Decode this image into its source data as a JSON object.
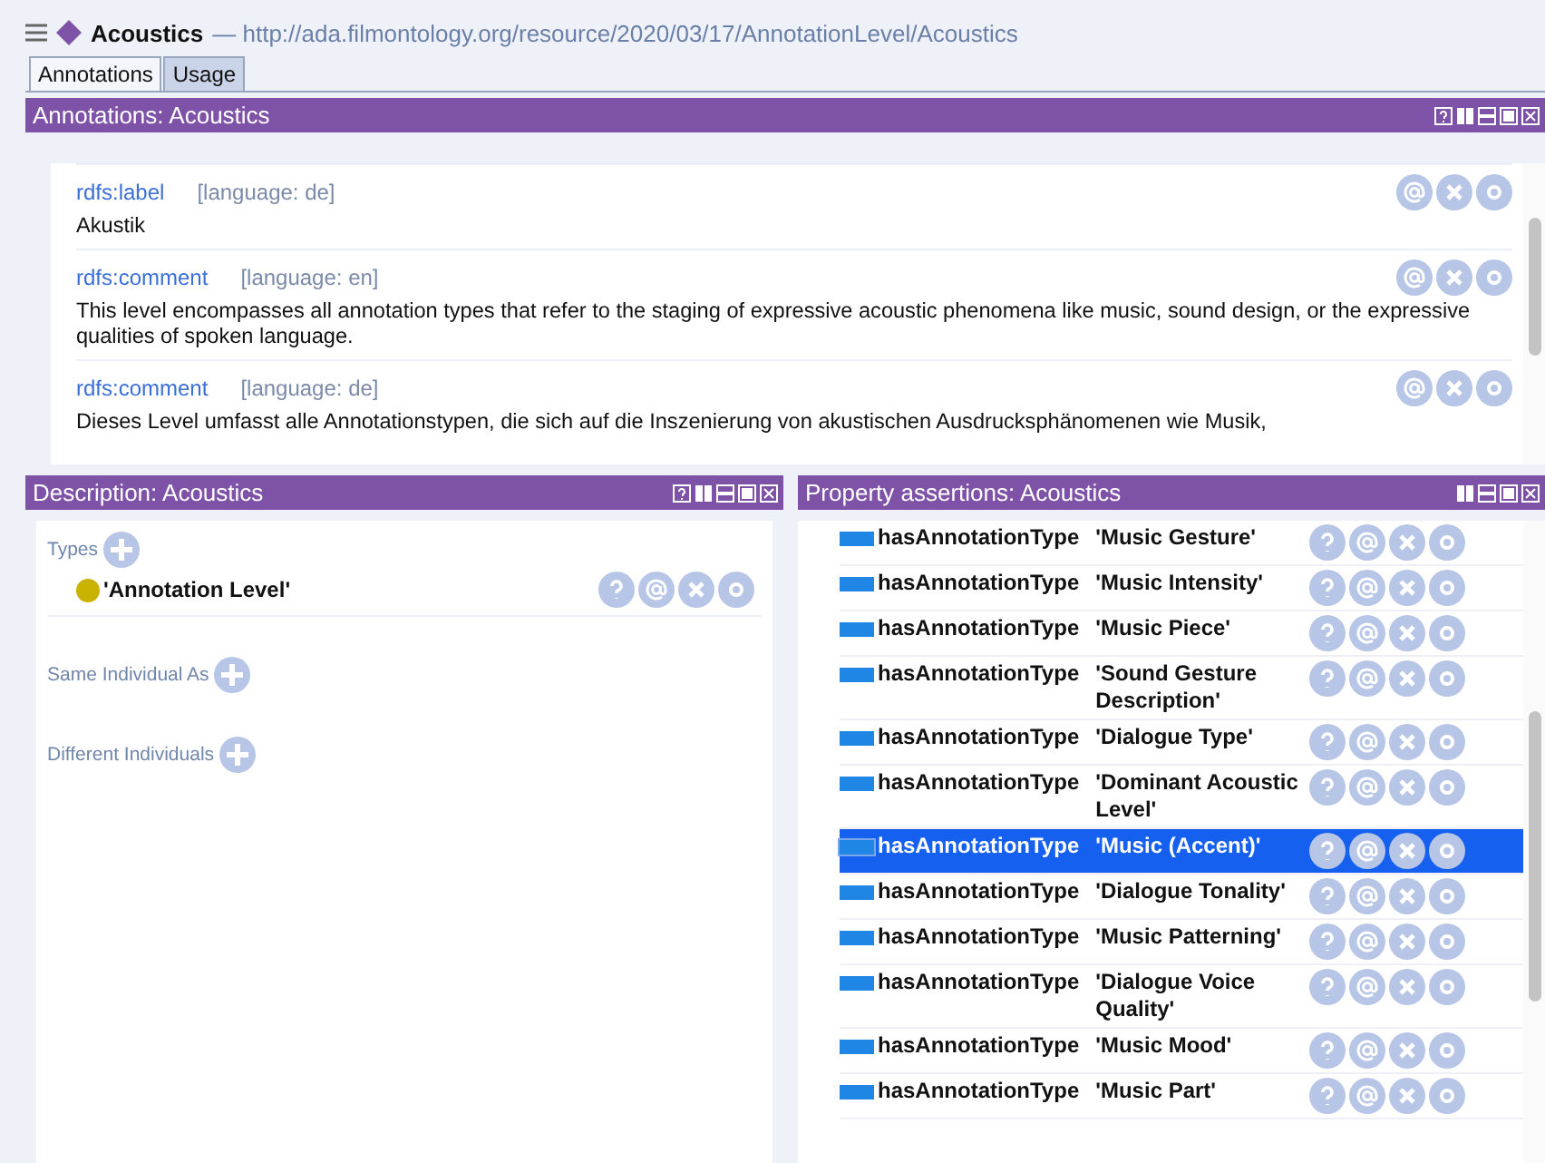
{
  "window": {
    "title": "Acoustics",
    "iri": "— http://ada.filmontology.org/resource/2020/03/17/AnnotationLevel/Acoustics"
  },
  "tabs": [
    {
      "label": "Annotations",
      "selected": true
    },
    {
      "label": "Usage",
      "selected": false
    }
  ],
  "annotations_panel": {
    "title": "Annotations: Acoustics",
    "has_help": true,
    "items": [
      {
        "property": "rdfs:label",
        "language": "[language: de]",
        "value": "Akustik"
      },
      {
        "property": "rdfs:comment",
        "language": "[language: en]",
        "value": "This level encompasses all annotation types that refer to the staging of expressive acoustic phenomena like music, sound design, or the expressive qualities of spoken language."
      },
      {
        "property": "rdfs:comment",
        "language": "[language: de]",
        "value": "Dieses Level umfasst alle Annotationstypen, die sich auf die Inszenierung von akustischen Ausdrucksphänomenen wie Musik,"
      }
    ]
  },
  "description_panel": {
    "title": "Description: Acoustics",
    "has_help": true,
    "sections": [
      {
        "label": "Types",
        "items": [
          {
            "label": "'Annotation Level'",
            "color": "#c9b200"
          }
        ]
      },
      {
        "label": "Same Individual As"
      },
      {
        "label": "Different Individuals"
      }
    ]
  },
  "property_panel": {
    "title": "Property assertions: Acoustics",
    "has_help": false,
    "rows": [
      {
        "property": "hasAnnotationType",
        "value": "'Music Gesture'",
        "selected": false
      },
      {
        "property": "hasAnnotationType",
        "value": "'Music Intensity'",
        "selected": false
      },
      {
        "property": "hasAnnotationType",
        "value": "'Music Piece'",
        "selected": false
      },
      {
        "property": "hasAnnotationType",
        "value": "'Sound Gesture Description'",
        "selected": false
      },
      {
        "property": "hasAnnotationType",
        "value": "'Dialogue Type'",
        "selected": false
      },
      {
        "property": "hasAnnotationType",
        "value": "'Dominant Acoustic Level'",
        "selected": false
      },
      {
        "property": "hasAnnotationType",
        "value": "'Music (Accent)'",
        "selected": true
      },
      {
        "property": "hasAnnotationType",
        "value": "'Dialogue Tonality'",
        "selected": false
      },
      {
        "property": "hasAnnotationType",
        "value": "'Music Patterning'",
        "selected": false
      },
      {
        "property": "hasAnnotationType",
        "value": "'Dialogue Voice Quality'",
        "selected": false
      },
      {
        "property": "hasAnnotationType",
        "value": "'Music Mood'",
        "selected": false
      },
      {
        "property": "hasAnnotationType",
        "value": "'Music Part'",
        "selected": false
      }
    ]
  }
}
